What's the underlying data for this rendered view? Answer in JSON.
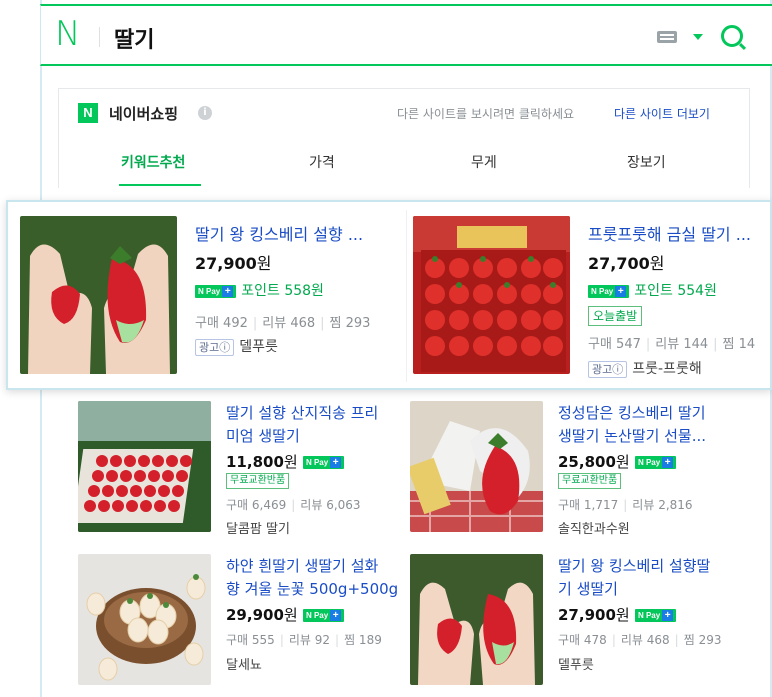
{
  "search": {
    "logo": "N",
    "query": "딸기"
  },
  "shopping": {
    "badge": "N",
    "title": "네이버쇼핑",
    "info": "i",
    "hint": "다른 사이트를 보시려면 클릭하세요",
    "more_link": "다른 사이트 더보기",
    "tabs": [
      "키워드추천",
      "가격",
      "무게",
      "장보기"
    ]
  },
  "npay": {
    "label": "N Pay",
    "plus": "+"
  },
  "featured": [
    {
      "name": "딸기 왕 킹스베리 설향 ...",
      "price": "27,900",
      "won": "원",
      "point": "포인트 558원",
      "buy": "구매 492",
      "review": "리뷰 468",
      "wish": "찜 293",
      "ad": "광고ⓘ",
      "store": "델푸릇"
    },
    {
      "name": "프룻프룻해 금실 딸기 ...",
      "price": "27,700",
      "won": "원",
      "point": "포인트 554원",
      "tag": "오늘출발",
      "buy": "구매 547",
      "review": "리뷰 144",
      "wish": "찜 14",
      "ad": "광고ⓘ",
      "store": "프룻-프룻해"
    }
  ],
  "products": [
    {
      "name_l1": "딸기 설향 산지직송 프리",
      "name_l2": "미엄 생딸기",
      "price": "11,800",
      "won": "원",
      "tag": "무료교환반품",
      "buy": "구매 6,469",
      "review": "리뷰 6,063",
      "store": "달콤팜 딸기"
    },
    {
      "name_l1": "정성담은 킹스베리 딸기",
      "name_l2": "생딸기 논산딸기 선물...",
      "price": "25,800",
      "won": "원",
      "tag": "무료교환반품",
      "buy": "구매 1,717",
      "review": "리뷰 2,816",
      "store": "솔직한과수원"
    },
    {
      "name_l1": "하얀 흰딸기 생딸기 설화",
      "name_l2": "향 겨울 눈꽃 500g+500g",
      "price": "29,900",
      "won": "원",
      "buy": "구매 555",
      "review": "리뷰 92",
      "wish": "찜 189",
      "store": "달세뇨"
    },
    {
      "name_l1": "딸기 왕 킹스베리 설향딸",
      "name_l2": "기 생딸기",
      "price": "27,900",
      "won": "원",
      "buy": "구매 478",
      "review": "리뷰 468",
      "wish": "찜 293",
      "store": "델푸릇"
    }
  ],
  "colors": {
    "brand_green": "#03c75a",
    "link_blue": "#1a4dc5"
  },
  "icons": [
    "naver-logo",
    "keyboard-icon",
    "dropdown-arrow-icon",
    "search-icon",
    "info-icon"
  ]
}
